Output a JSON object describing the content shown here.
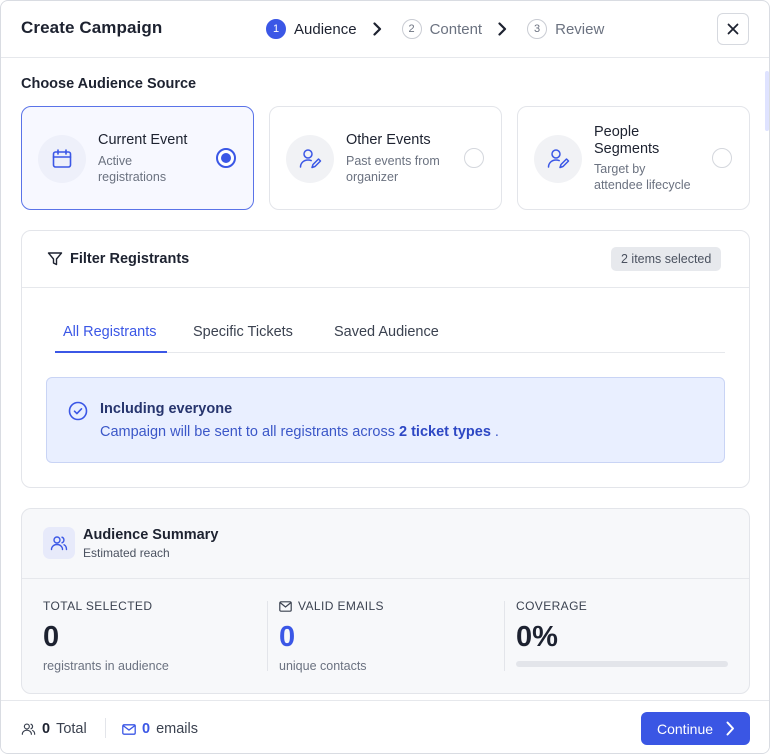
{
  "header": {
    "title": "Create Campaign",
    "steps": [
      {
        "num": "1",
        "label": "Audience"
      },
      {
        "num": "2",
        "label": "Content"
      },
      {
        "num": "3",
        "label": "Review"
      }
    ]
  },
  "audience_source": {
    "title": "Choose Audience Source",
    "options": [
      {
        "title": "Current Event",
        "desc_line1": "Active",
        "desc_line2": "registrations"
      },
      {
        "title": "Other Events",
        "desc_line1": "Past events from",
        "desc_line2": "organizer"
      },
      {
        "title_line1": "People",
        "title_line2": "Segments",
        "desc_line1": "Target by",
        "desc_line2": "attendee lifecycle"
      }
    ]
  },
  "filter": {
    "title": "Filter Registrants",
    "badge": "2 items selected",
    "tabs": [
      "All Registrants",
      "Specific Tickets",
      "Saved Audience"
    ],
    "info_title": "Including everyone",
    "info_text_prefix": "Campaign will be sent to all registrants across ",
    "info_text_bold": "2 ticket types",
    "info_text_suffix": " ."
  },
  "summary": {
    "title": "Audience Summary",
    "subtitle": "Estimated reach",
    "metrics": [
      {
        "label": "TOTAL SELECTED",
        "value": "0",
        "sub": "registrants in audience"
      },
      {
        "label": "VALID EMAILS",
        "value": "0",
        "sub": "unique contacts"
      },
      {
        "label": "COVERAGE",
        "value": "0%",
        "progress": 0
      }
    ]
  },
  "footer": {
    "total_value": "0",
    "total_label": "Total",
    "emails_value": "0",
    "emails_label": "emails",
    "continue_label": "Continue"
  },
  "colors": {
    "accent": "#3b57e6",
    "info_bg": "#e9efff",
    "border": "#e3e5ea"
  }
}
